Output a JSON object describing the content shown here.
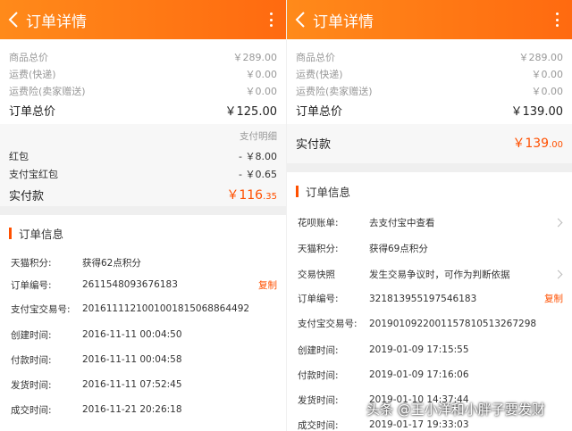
{
  "left": {
    "title": "订单详情",
    "prices": [
      {
        "label": "商品总价",
        "value": "￥289.00"
      },
      {
        "label": "运费(快递)",
        "value": "￥0.00"
      },
      {
        "label": "运费险(卖家赠送)",
        "value": "￥0.00"
      }
    ],
    "order_total_label": "订单总价",
    "order_total_value": "￥125.00",
    "pay_detail": "支付明细",
    "payments": [
      {
        "label": "红包",
        "value": "- ￥8.00"
      },
      {
        "label": "支付宝红包",
        "value": "- ￥0.65"
      }
    ],
    "real_label": "实付款",
    "real_main": "￥116",
    "real_cents": ".35",
    "info_title": "订单信息",
    "info": [
      {
        "label": "天猫积分:",
        "value": "获得62点积分"
      },
      {
        "label": "订单编号:",
        "value": "2611548093676183",
        "action": "复制"
      },
      {
        "label": "支付宝交易号:",
        "value": "2016111121001001815068864492"
      },
      {
        "label": "创建时间:",
        "value": "2016-11-11 00:04:50"
      },
      {
        "label": "付款时间:",
        "value": "2016-11-11 00:04:58"
      },
      {
        "label": "发货时间:",
        "value": "2016-11-11 07:52:45"
      },
      {
        "label": "成交时间:",
        "value": "2016-11-21 20:26:18"
      }
    ]
  },
  "right": {
    "title": "订单详情",
    "prices": [
      {
        "label": "商品总价",
        "value": "￥289.00"
      },
      {
        "label": "运费(快递)",
        "value": "￥0.00"
      },
      {
        "label": "运费险(卖家赠送)",
        "value": "￥0.00"
      }
    ],
    "order_total_label": "订单总价",
    "order_total_value": "￥139.00",
    "real_label": "实付款",
    "real_main": "￥139",
    "real_cents": ".00",
    "info_title": "订单信息",
    "info": [
      {
        "label": "花呗账单:",
        "value": "去支付宝中查看"
      },
      {
        "label": "天猫积分:",
        "value": "获得69点积分"
      },
      {
        "label": "交易快照",
        "value": "发生交易争议时，可作为判断依据"
      },
      {
        "label": "订单编号:",
        "value": "321813955197546183",
        "action": "复制"
      },
      {
        "label": "支付宝交易号:",
        "value": "2019010922001157810513267298"
      },
      {
        "label": "创建时间:",
        "value": "2019-01-09 17:15:55"
      },
      {
        "label": "付款时间:",
        "value": "2019-01-09 17:16:06"
      },
      {
        "label": "发货时间:",
        "value": "2019-01-10 14:37:44"
      },
      {
        "label": "成交时间:",
        "value": "2019-01-17 19:33:03"
      }
    ]
  },
  "watermark": "头条 @王小洋和小胖子要发财",
  "colors": {
    "header": "#ff7214",
    "accent": "#ff5000"
  }
}
